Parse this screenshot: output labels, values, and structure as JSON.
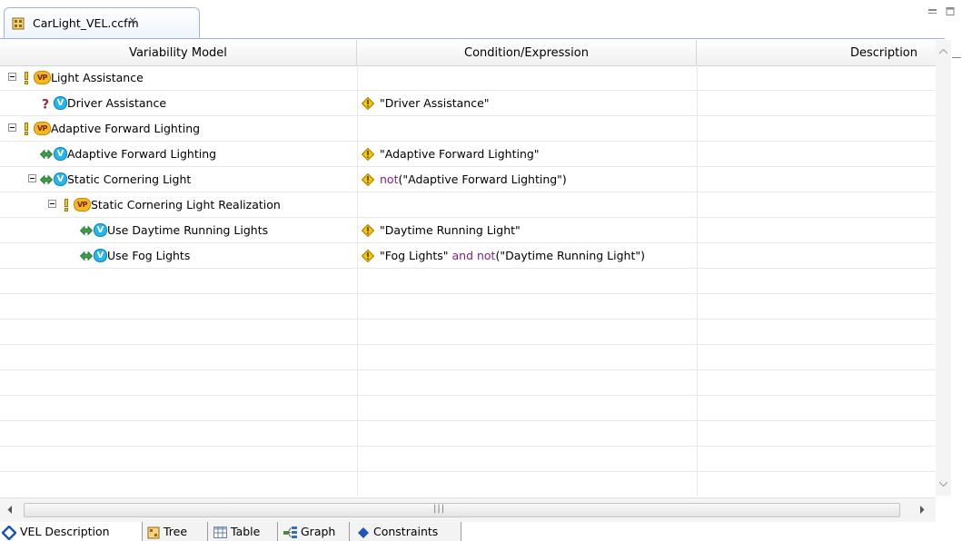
{
  "editor": {
    "tab_title": "CarLight_VEL.ccfm",
    "close_glyph": "✕"
  },
  "table": {
    "columns": [
      "Variability Model",
      "Condition/Expression",
      "Description"
    ],
    "rows": [
      {
        "level": 0,
        "expander": true,
        "status_icon": "exclamation-icon",
        "kind": "VP",
        "name": "Light Assistance",
        "condition": []
      },
      {
        "level": 1,
        "expander": false,
        "status_icon": "question-icon",
        "kind": "V",
        "name": "Driver Assistance",
        "condition": [
          {
            "t": "\"Driver Assistance\""
          }
        ]
      },
      {
        "level": 0,
        "expander": true,
        "status_icon": "exclamation-icon",
        "kind": "VP",
        "name": "Adaptive Forward Lighting",
        "condition": []
      },
      {
        "level": 1,
        "expander": false,
        "status_icon": "bidirectional-arrow-icon",
        "kind": "V",
        "name": "Adaptive Forward Lighting",
        "condition": [
          {
            "t": "\"Adaptive Forward Lighting\""
          }
        ]
      },
      {
        "level": 1,
        "expander": true,
        "status_icon": "bidirectional-arrow-icon",
        "kind": "V",
        "name": "Static Cornering Light",
        "condition": [
          {
            "t": "not",
            "kw": true
          },
          {
            "t": "(\"Adaptive Forward Lighting\")"
          }
        ]
      },
      {
        "level": 2,
        "expander": true,
        "status_icon": "exclamation-icon",
        "kind": "VP",
        "name": "Static Cornering Light Realization",
        "condition": []
      },
      {
        "level": 3,
        "expander": false,
        "status_icon": "bidirectional-arrow-icon",
        "kind": "V",
        "name": "Use Daytime Running Lights",
        "condition": [
          {
            "t": "\"Daytime Running Light\""
          }
        ]
      },
      {
        "level": 3,
        "expander": false,
        "status_icon": "bidirectional-arrow-icon",
        "kind": "V",
        "name": "Use Fog Lights",
        "condition": [
          {
            "t": "\"Fog Lights\" "
          },
          {
            "t": "and not",
            "kw": true
          },
          {
            "t": "(\"Daytime Running Light\")"
          }
        ]
      }
    ],
    "badges": {
      "V": "V",
      "VP": "VP"
    }
  },
  "bottom_tabs": [
    {
      "label": "VEL Description",
      "icon": "diamond-outline-icon"
    },
    {
      "label": "Tree",
      "icon": "tree-icon"
    },
    {
      "label": "Table",
      "icon": "table-icon"
    },
    {
      "label": "Graph",
      "icon": "graph-icon"
    },
    {
      "label": "Constraints",
      "icon": "constraints-diamond-icon"
    }
  ],
  "colors": {
    "keyword": "#7f1f7f",
    "tab_border": "#9db5d8",
    "variant_badge": "#25b6ea",
    "vp_badge": "#f3b722",
    "warning": "#f5c400",
    "arrow": "#3aa04a"
  }
}
